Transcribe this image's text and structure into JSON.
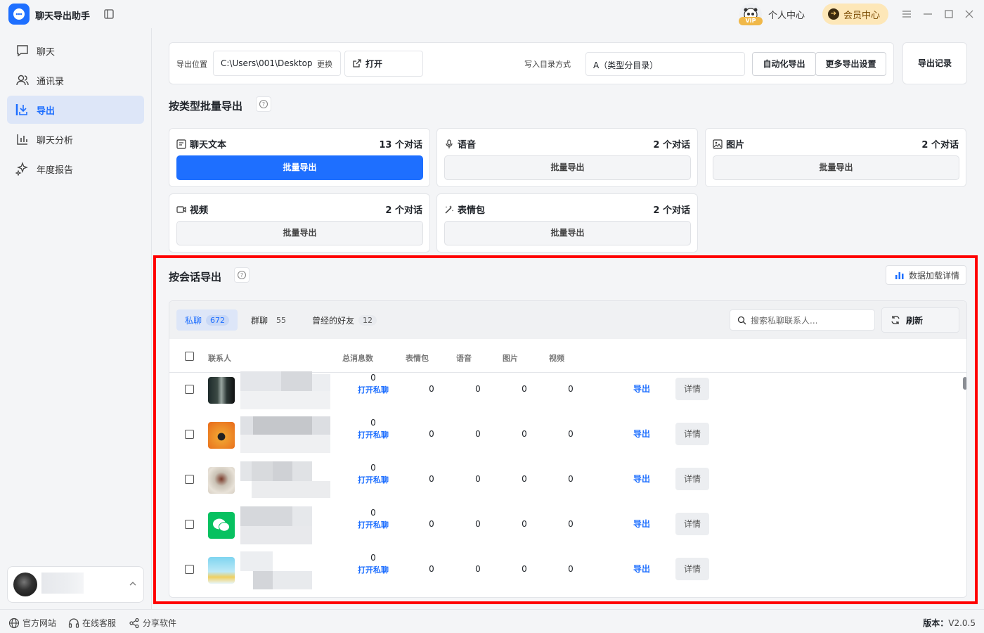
{
  "app": {
    "title": "聊天导出助手"
  },
  "header": {
    "vip_badge": "VIP",
    "profile_label": "个人中心",
    "member_label": "会员中心"
  },
  "sidebar": {
    "items": [
      {
        "label": "聊天",
        "icon": "chat-icon"
      },
      {
        "label": "通讯录",
        "icon": "contacts-icon"
      },
      {
        "label": "导出",
        "icon": "export-icon",
        "active": true
      },
      {
        "label": "聊天分析",
        "icon": "bar-chart-icon"
      },
      {
        "label": "年度报告",
        "icon": "sparkle-icon"
      }
    ]
  },
  "footer": {
    "website": "官方网站",
    "support": "在线客服",
    "share": "分享软件",
    "version_label": "版本：",
    "version_value": "V2.0.5"
  },
  "toolbar": {
    "location_label": "导出位置",
    "path": "C:\\Users\\001\\Desktop",
    "change_label": "更换",
    "open_label": "打开",
    "mode_label": "写入目录方式",
    "mode_value": "A（类型分目录）",
    "auto_export": "自动化导出",
    "more_settings": "更多导出设置",
    "export_record": "导出记录"
  },
  "batch": {
    "title": "按类型批量导出",
    "cards": [
      {
        "label": "聊天文本",
        "count": "13 个对话",
        "button": "批量导出",
        "icon": "text-icon"
      },
      {
        "label": "语音",
        "count": "2 个对话",
        "button": "批量导出",
        "icon": "mic-icon"
      },
      {
        "label": "图片",
        "count": "2 个对话",
        "button": "批量导出",
        "icon": "image-icon"
      },
      {
        "label": "视频",
        "count": "2 个对话",
        "button": "批量导出",
        "icon": "video-icon"
      },
      {
        "label": "表情包",
        "count": "2 个对话",
        "button": "批量导出",
        "icon": "magic-wand-icon"
      }
    ]
  },
  "session": {
    "title": "按会话导出",
    "data_detail": "数据加载详情",
    "tabs": [
      {
        "label": "私聊",
        "count": "672"
      },
      {
        "label": "群聊",
        "count": "55"
      },
      {
        "label": "曾经的好友",
        "count": "12"
      }
    ],
    "search_placeholder": "搜索私聊联系人...",
    "refresh": "刷新",
    "columns": [
      "联系人",
      "总消息数",
      "表情包",
      "语音",
      "图片",
      "视频"
    ],
    "rows": [
      {
        "total": "0",
        "open": "打开私聊",
        "emoji": "0",
        "voice": "0",
        "image": "0",
        "video": "0",
        "export": "导出",
        "detail": "详情"
      },
      {
        "total": "0",
        "open": "打开私聊",
        "emoji": "0",
        "voice": "0",
        "image": "0",
        "video": "0",
        "export": "导出",
        "detail": "详情"
      },
      {
        "total": "0",
        "open": "打开私聊",
        "emoji": "0",
        "voice": "0",
        "image": "0",
        "video": "0",
        "export": "导出",
        "detail": "详情"
      },
      {
        "total": "0",
        "open": "打开私聊",
        "emoji": "0",
        "voice": "0",
        "image": "0",
        "video": "0",
        "export": "导出",
        "detail": "详情"
      },
      {
        "total": "0",
        "open": "打开私聊",
        "emoji": "0",
        "voice": "0",
        "image": "0",
        "video": "0",
        "export": "导出",
        "detail": "详情"
      }
    ]
  },
  "colors": {
    "accent": "#1e6fff",
    "highlight": "#ff0000",
    "member_bg": "#fde7b8"
  }
}
